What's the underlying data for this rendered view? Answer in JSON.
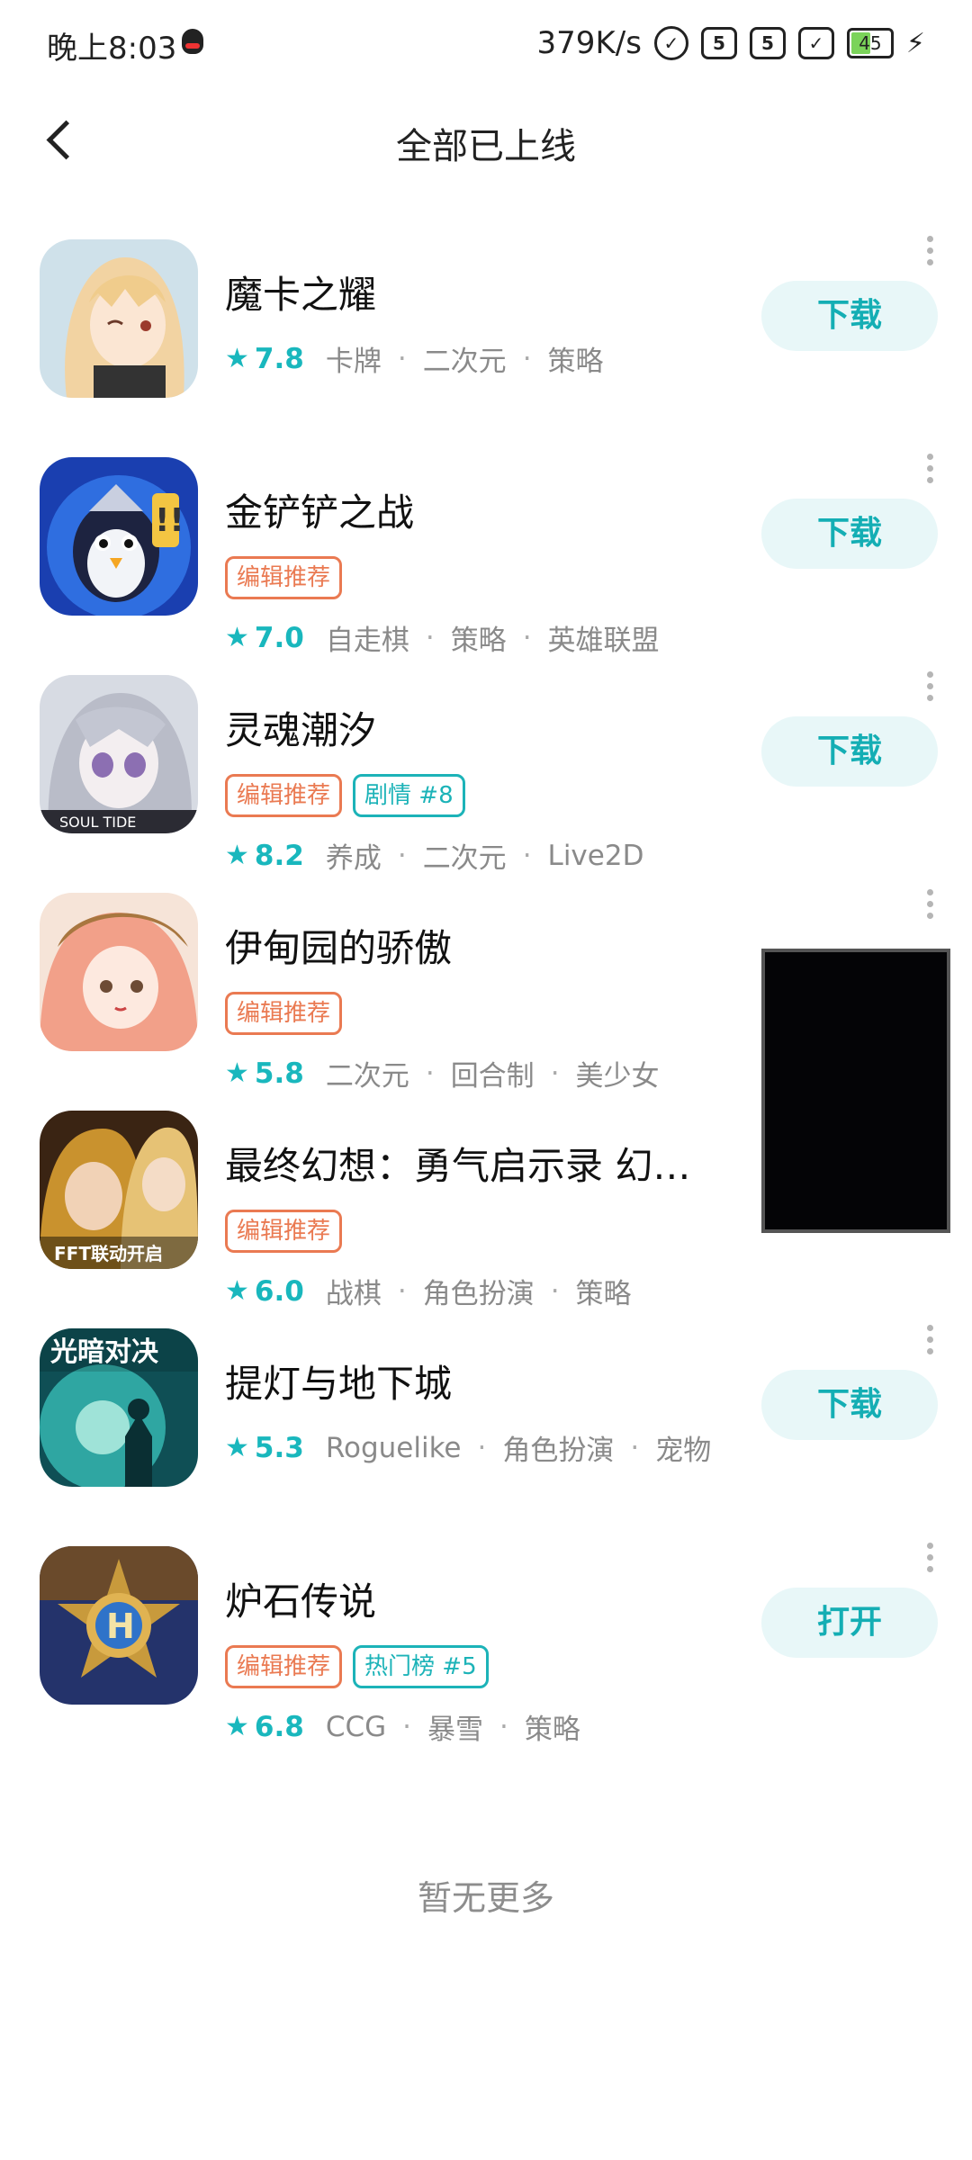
{
  "status_bar": {
    "time": "晚上8:03",
    "network_speed": "379K/s",
    "sim1": "5",
    "sim2": "5",
    "battery": "45"
  },
  "header": {
    "title": "全部已上线"
  },
  "apps": [
    {
      "name": "魔卡之耀",
      "tags": [],
      "score": "7.8",
      "genres": [
        "卡牌",
        "二次元",
        "策略"
      ],
      "button": "下载"
    },
    {
      "name": "金铲铲之战",
      "tags": [
        "编辑推荐"
      ],
      "score": "7.0",
      "genres": [
        "自走棋",
        "策略",
        "英雄联盟"
      ],
      "button": "下载"
    },
    {
      "name": "灵魂潮汐",
      "tags": [
        "编辑推荐",
        "剧情 #8"
      ],
      "score": "8.2",
      "genres": [
        "养成",
        "二次元",
        "Live2D"
      ],
      "button": "下载"
    },
    {
      "name": "伊甸园的骄傲",
      "tags": [
        "编辑推荐"
      ],
      "score": "5.8",
      "genres": [
        "二次元",
        "回合制",
        "美少女"
      ],
      "button": ""
    },
    {
      "name": "最终幻想：勇气启示录 幻…",
      "tags": [
        "编辑推荐"
      ],
      "score": "6.0",
      "genres": [
        "战棋",
        "角色扮演",
        "策略"
      ],
      "button": ""
    },
    {
      "name": "提灯与地下城",
      "tags": [],
      "score": "5.3",
      "genres": [
        "Roguelike",
        "角色扮演",
        "宠物"
      ],
      "button": "下载"
    },
    {
      "name": "炉石传说",
      "tags": [
        "编辑推荐",
        "热门榜 #5"
      ],
      "score": "6.8",
      "genres": [
        "CCG",
        "暴雪",
        "策略"
      ],
      "button": "打开"
    }
  ],
  "footer": {
    "no_more": "暂无更多"
  },
  "icon_text": {
    "soul_tide": "SOUL TIDE",
    "fft": "FFT联动开启",
    "light_dark": "光暗对决"
  }
}
